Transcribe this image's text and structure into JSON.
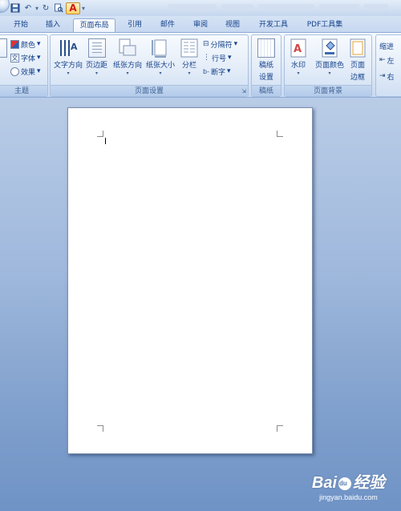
{
  "quick_access": {
    "font_color_glyph": "A",
    "icons": [
      "save-icon",
      "undo-icon",
      "redo-icon",
      "print-preview-icon",
      "font-color-icon",
      "customize-icon"
    ]
  },
  "tabs": [
    {
      "label": "开始"
    },
    {
      "label": "插入"
    },
    {
      "label": "页面布局",
      "active": true
    },
    {
      "label": "引用"
    },
    {
      "label": "邮件"
    },
    {
      "label": "审阅"
    },
    {
      "label": "视图"
    },
    {
      "label": "开发工具"
    },
    {
      "label": "PDF工具集"
    }
  ],
  "ribbon": {
    "theme_group": {
      "label": "主题",
      "colors": "颜色",
      "fonts": "字体",
      "effects": "效果",
      "fonts_icon_glyph": "文"
    },
    "page_setup_group": {
      "label": "页面设置",
      "text_direction": "文字方向",
      "margins": "页边距",
      "orientation": "纸张方向",
      "size": "纸张大小",
      "columns": "分栏",
      "breaks": "分隔符",
      "line_numbers": "行号",
      "hyphenation": "断字"
    },
    "manuscript_group": {
      "label": "稿纸",
      "manuscript_settings_line1": "稿纸",
      "manuscript_settings_line2": "设置"
    },
    "page_background_group": {
      "label": "页面背景",
      "watermark": "水印",
      "page_color": "页面颜色",
      "page_borders_line1": "页面",
      "page_borders_line2": "边框"
    },
    "paragraph_group": {
      "indent": "缩进",
      "left": "左",
      "right": "右"
    }
  },
  "watermark": {
    "logo_left": "Bai",
    "logo_right": "经验",
    "url": "jingyan.baidu.com"
  },
  "colors": {
    "accent": "#15428b",
    "workspace": "#8fa9d3",
    "page": "#ffffff"
  }
}
